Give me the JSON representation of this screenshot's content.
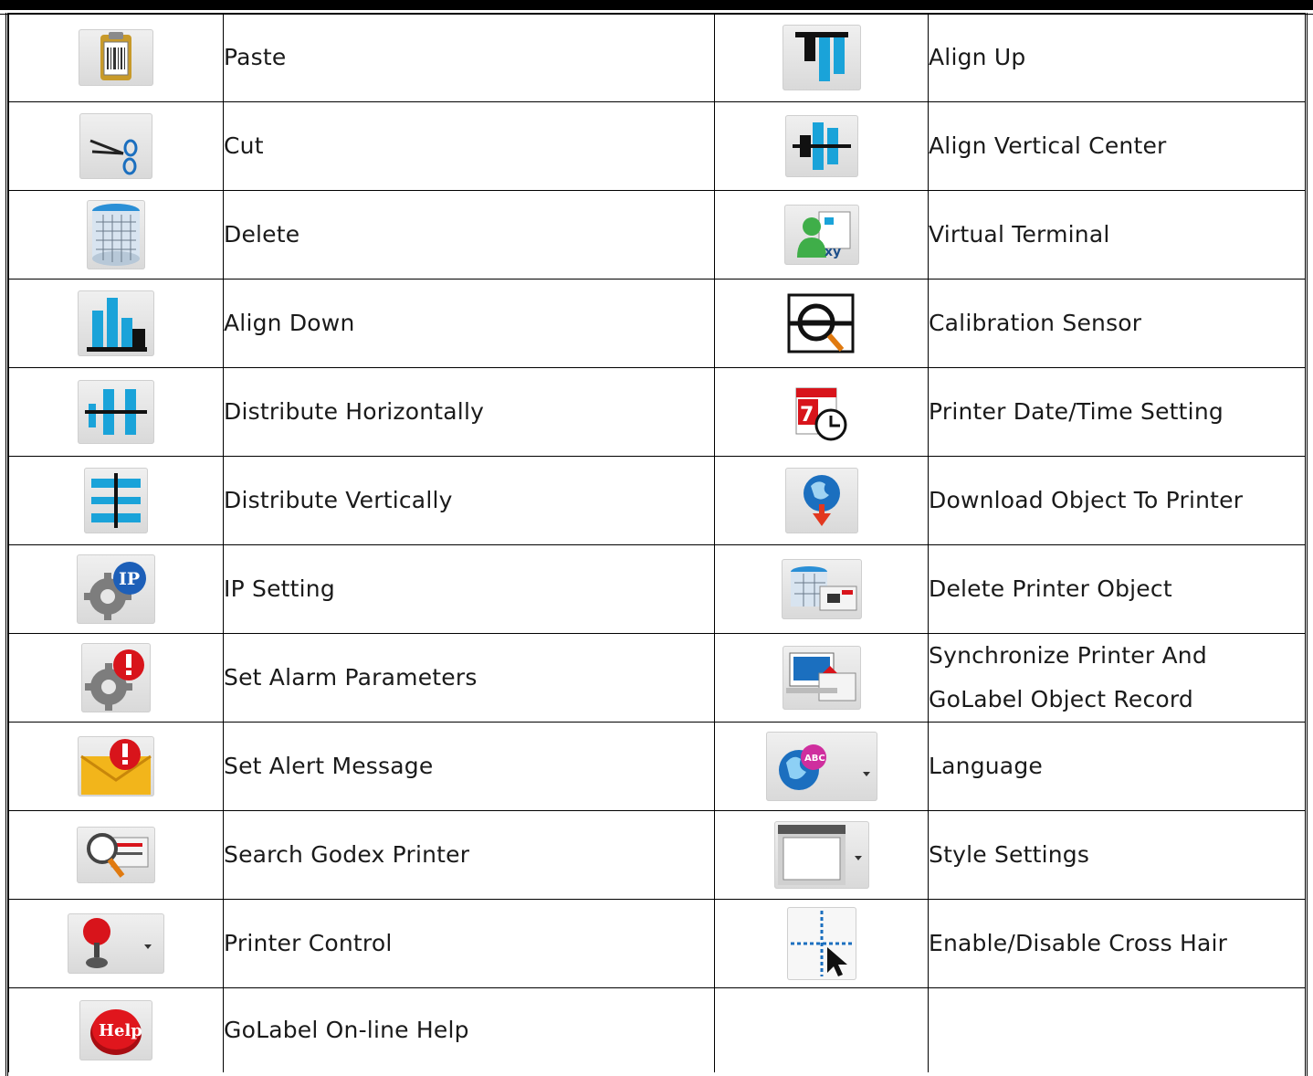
{
  "rows": [
    {
      "left": {
        "label": "Paste",
        "icon": "paste-icon"
      },
      "right": {
        "label": "Align Up",
        "icon": "align-up-icon"
      }
    },
    {
      "left": {
        "label": "Cut",
        "icon": "cut-icon"
      },
      "right": {
        "label": "Align Vertical Center",
        "icon": "align-vertical-center-icon"
      }
    },
    {
      "left": {
        "label": "Delete",
        "icon": "delete-icon"
      },
      "right": {
        "label": "Virtual Terminal",
        "icon": "virtual-terminal-icon"
      }
    },
    {
      "left": {
        "label": "Align Down",
        "icon": "align-down-icon"
      },
      "right": {
        "label": "Calibration Sensor",
        "icon": "calibration-sensor-icon"
      }
    },
    {
      "left": {
        "label": "Distribute Horizontally",
        "icon": "distribute-horizontally-icon"
      },
      "right": {
        "label": "Printer Date/Time Setting",
        "icon": "printer-date-time-icon",
        "glyph": "7"
      }
    },
    {
      "left": {
        "label": "Distribute Vertically",
        "icon": "distribute-vertically-icon"
      },
      "right": {
        "label": "Download Object To Printer",
        "icon": "download-object-icon"
      }
    },
    {
      "left": {
        "label": "IP Setting",
        "icon": "ip-setting-icon",
        "glyph": "IP"
      },
      "right": {
        "label": "Delete Printer Object",
        "icon": "delete-printer-object-icon"
      }
    },
    {
      "left": {
        "label": "Set Alarm Parameters",
        "icon": "set-alarm-parameters-icon"
      },
      "right": {
        "label_line1": "Synchronize Printer And",
        "label_line2": "GoLabel Object Record",
        "icon": "synchronize-icon"
      }
    },
    {
      "left": {
        "label": "Set Alert Message",
        "icon": "set-alert-message-icon"
      },
      "right": {
        "label": "Language",
        "icon": "language-icon",
        "glyph": "ABC"
      }
    },
    {
      "left": {
        "label": "Search Godex Printer",
        "icon": "search-printer-icon"
      },
      "right": {
        "label": "Style Settings",
        "icon": "style-settings-icon"
      }
    },
    {
      "left": {
        "label": "Printer Control",
        "icon": "printer-control-icon"
      },
      "right": {
        "label": "Enable/Disable Cross Hair",
        "icon": "cross-hair-icon"
      }
    },
    {
      "left": {
        "label": "GoLabel On-line Help",
        "icon": "help-icon",
        "glyph": "Help"
      },
      "right": {
        "label": "",
        "icon": ""
      }
    }
  ],
  "colors": {
    "accent_blue": "#1aa3d9",
    "alert_red": "#d8141b",
    "border": "#000000"
  }
}
